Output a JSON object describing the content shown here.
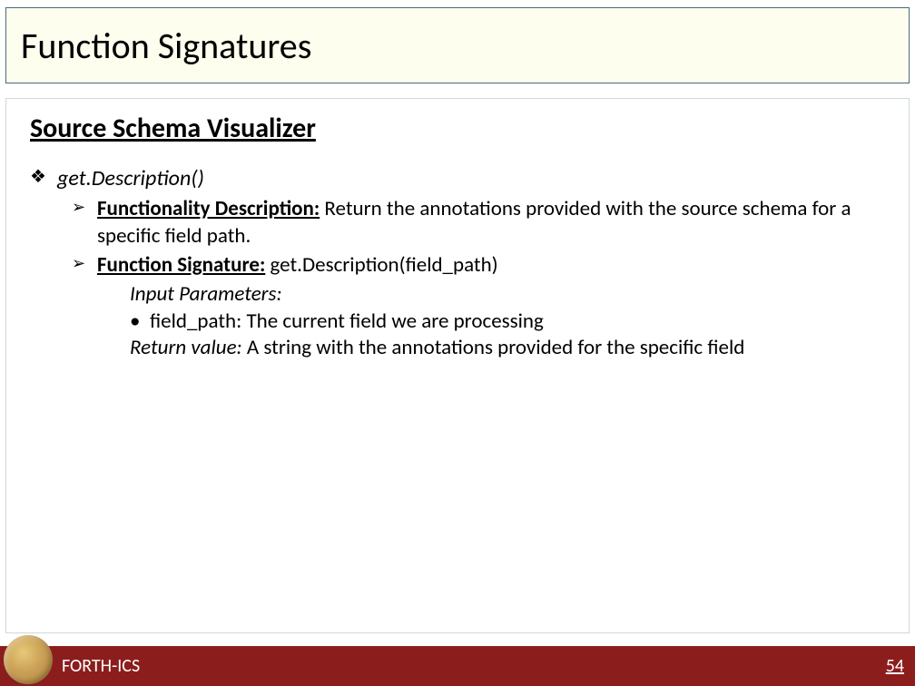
{
  "title": "Function Signatures",
  "section": "Source Schema Visualizer",
  "item": {
    "name": "get.Description()",
    "funcdesc_label": "Functionality Description:",
    "funcdesc_text": " Return the annotations provided with the source schema for a specific field path.",
    "funcsig_label": "Function Signature:",
    "funcsig_text": " get.Description(field_path)",
    "input_params_head": "Input Parameters:",
    "params": [
      {
        "name": "field_path:",
        "desc": " The current field we are processing"
      }
    ],
    "return_label": "Return value:",
    "return_text": " A string with the annotations provided for the specific field"
  },
  "footer": {
    "org": "FORTH-ICS",
    "page": "54"
  }
}
